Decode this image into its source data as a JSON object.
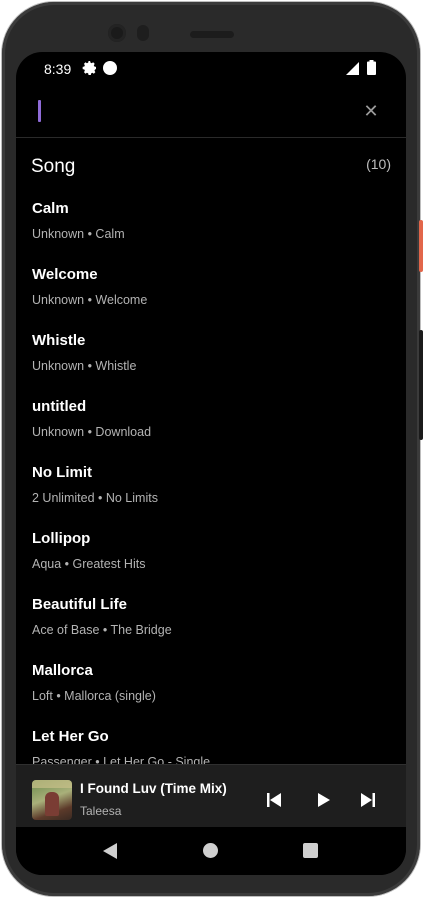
{
  "status_bar": {
    "time": "8:39"
  },
  "search": {
    "value": "",
    "placeholder": "",
    "close_icon": "close-icon"
  },
  "section": {
    "title": "Song",
    "count": "(10)"
  },
  "songs": [
    {
      "title": "Calm",
      "subtitle": "Unknown • Calm"
    },
    {
      "title": "Welcome",
      "subtitle": "Unknown • Welcome"
    },
    {
      "title": "Whistle",
      "subtitle": "Unknown • Whistle"
    },
    {
      "title": "untitled",
      "subtitle": "Unknown • Download"
    },
    {
      "title": "No Limit",
      "subtitle": "2 Unlimited • No Limits"
    },
    {
      "title": "Lollipop",
      "subtitle": "Aqua • Greatest Hits"
    },
    {
      "title": "Beautiful Life",
      "subtitle": "Ace of Base • The Bridge"
    },
    {
      "title": "Mallorca",
      "subtitle": "Loft • Mallorca (single)"
    },
    {
      "title": "Let Her Go",
      "subtitle": "Passenger • Let Her Go - Single"
    }
  ],
  "player": {
    "title": "I Found Luv (Time Mix)",
    "artist": "Taleesa",
    "icons": [
      "skip-previous-icon",
      "play-icon",
      "skip-next-icon"
    ]
  },
  "colors": {
    "background": "#000000",
    "accent_cursor": "#8f6bd8",
    "secondary_text": "#b3b3b3",
    "player_bg": "#1e1e1e"
  }
}
